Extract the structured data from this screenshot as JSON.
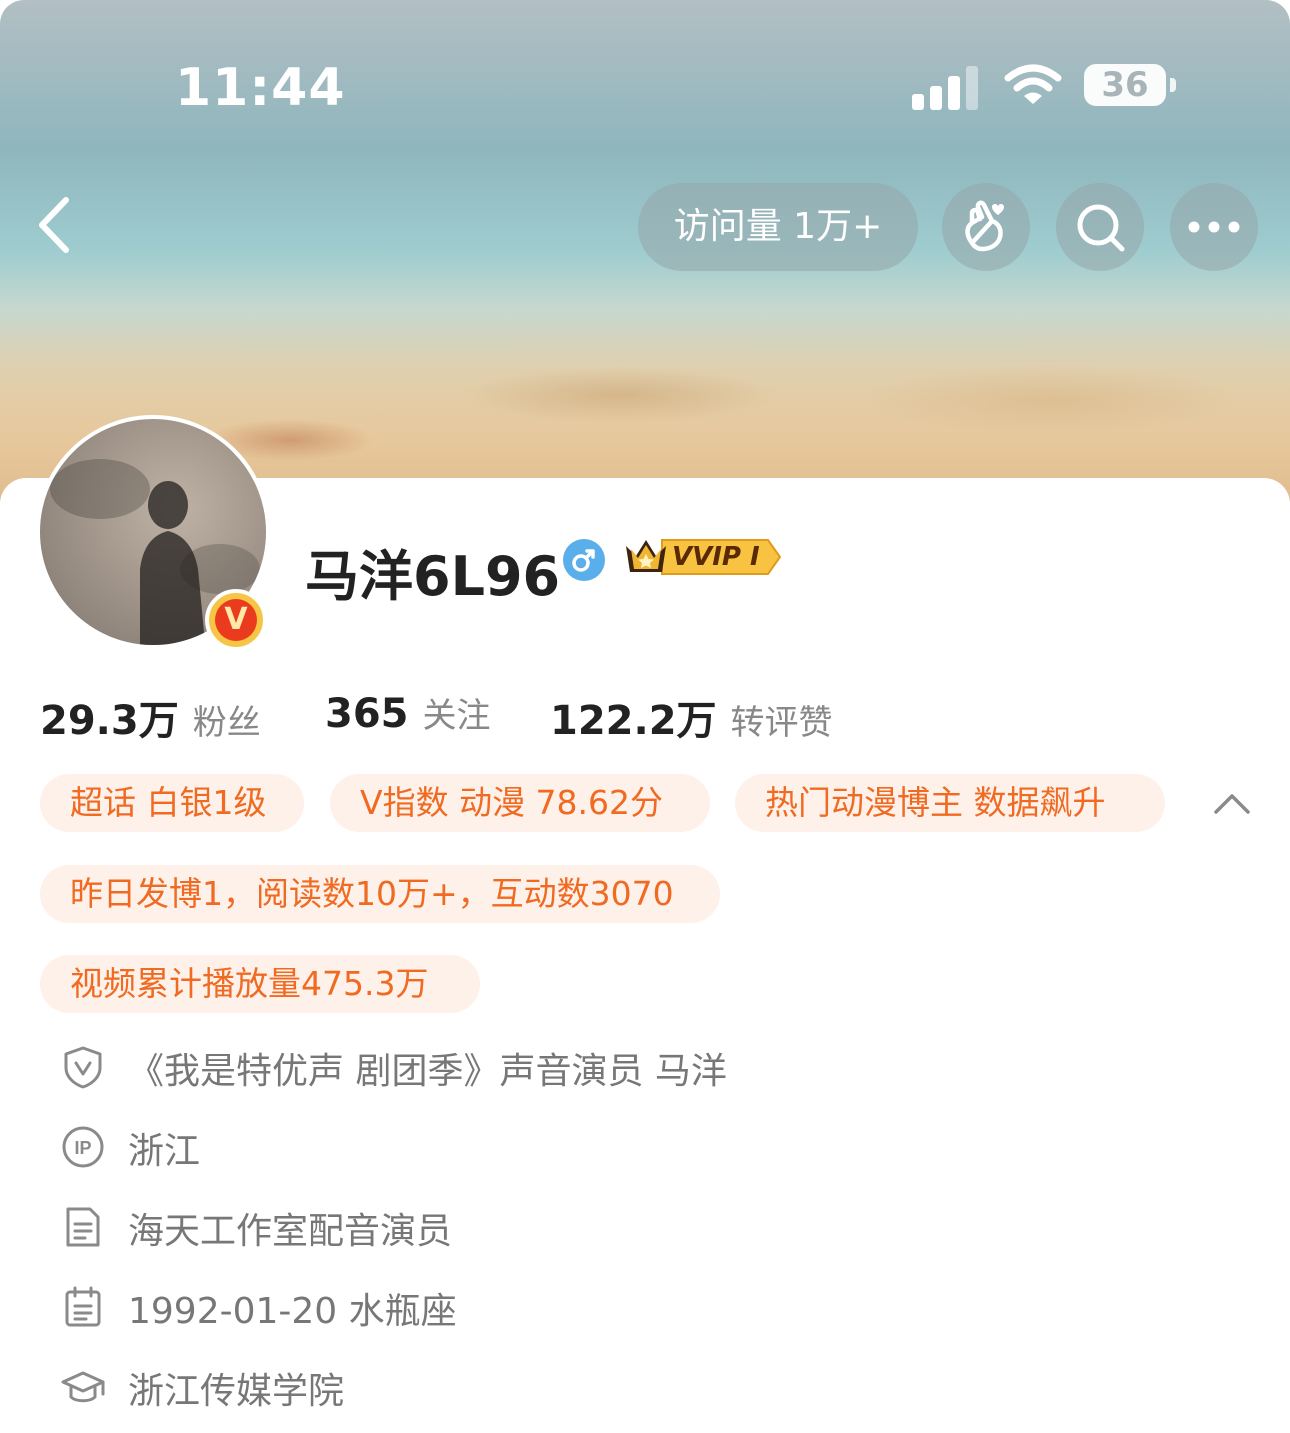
{
  "status_bar": {
    "time": "11:44",
    "battery": "36"
  },
  "header": {
    "visits_label": "访问量 1万+",
    "icons": [
      "back-arrow-icon",
      "hand-heart-icon",
      "search-icon",
      "more-icon"
    ]
  },
  "profile": {
    "username": "马洋6L96",
    "verified_badge": "V",
    "vip_label": "VVIP I",
    "gender": "male",
    "stats": [
      {
        "value": "29.3万",
        "label": "粉丝"
      },
      {
        "value": "365",
        "label": "关注"
      },
      {
        "value": "122.2万",
        "label": "转评赞"
      }
    ],
    "tags": [
      "超话 白银1级",
      "V指数 动漫 78.62分",
      "热门动漫博主 数据飙升",
      "昨日发博1，阅读数10万+，互动数3070",
      "视频累计播放量475.3万"
    ],
    "info": [
      {
        "icon": "verified-shield-icon",
        "text": "《我是特优声 剧团季》声音演员  马洋"
      },
      {
        "icon": "ip-location-icon",
        "text": "浙江"
      },
      {
        "icon": "document-icon",
        "text": "海天工作室配音演员"
      },
      {
        "icon": "calendar-icon",
        "text": "1992-01-20 水瓶座"
      },
      {
        "icon": "graduation-cap-icon",
        "text": "浙江传媒学院"
      }
    ]
  },
  "colors": {
    "tag_text": "#f06a22",
    "tag_bg": "#fdf1ea",
    "gender_blue": "#5aaeea",
    "verified_red": "#ea3b1e",
    "vip_gold": "#f7c341"
  }
}
